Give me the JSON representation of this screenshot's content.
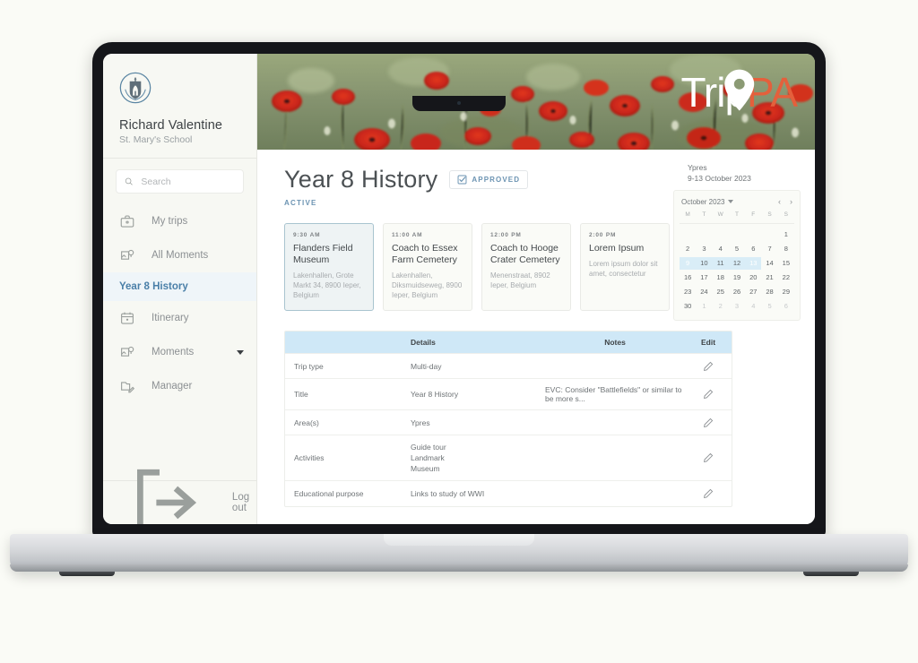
{
  "sidebar": {
    "user_name": "Richard Valentine",
    "user_org": "St. Mary's School",
    "logo_name": "school-crest-logo",
    "search_placeholder": "Search",
    "search_value": "",
    "items": [
      {
        "label": "My trips",
        "icon": "briefcase-icon"
      },
      {
        "label": "All Moments",
        "icon": "photo-pin-icon"
      }
    ],
    "section_label": "Year 8 History",
    "sub_items": [
      {
        "label": "Itinerary",
        "icon": "calendar-icon",
        "caret": false
      },
      {
        "label": "Moments",
        "icon": "photo-pin-icon",
        "caret": true
      },
      {
        "label": "Manager",
        "icon": "folder-edit-icon",
        "caret": false
      }
    ],
    "logout_label": "Log out",
    "logout_icon": "logout-icon"
  },
  "hero": {
    "image_alt": "poppy-field",
    "logo_part1": "Trip",
    "logo_part2": "PA",
    "logo_accent_color": "#e4603c",
    "pin_icon": "map-pin-icon"
  },
  "header": {
    "page_title": "Year 8 History",
    "badge_label": "APPROVED",
    "badge_icon": "check-square-icon",
    "status": "ACTIVE",
    "accent_color": "#6b93b2"
  },
  "itinerary_cards": [
    {
      "time": "9:30 AM",
      "title": "Flanders Field Museum",
      "address": "Lakenhallen, Grote Markt 34, 8900 Ieper, Belgium",
      "selected": true
    },
    {
      "time": "11:00 AM",
      "title": "Coach to Essex Farm Cemetery",
      "address": "Lakenhallen, Diksmuidseweg, 8900 Ieper, Belgium",
      "selected": false
    },
    {
      "time": "12:00 PM",
      "title": "Coach to Hooge Crater Cemetery",
      "address": "Menenstraat, 8902 Ieper, Belgium",
      "selected": false
    },
    {
      "time": "2:00 PM",
      "title": "Lorem Ipsum",
      "address": "Lorem ipsum dolor sit amet, consectetur",
      "selected": false
    }
  ],
  "table": {
    "headers": [
      "",
      "Details",
      "Notes",
      "Edit"
    ],
    "rows": [
      {
        "label": "Trip type",
        "details": "Multi-day",
        "notes": ""
      },
      {
        "label": "Title",
        "details": "Year 8 History",
        "notes": "EVC: Consider \"Battlefields\" or similar to be more s..."
      },
      {
        "label": "Area(s)",
        "details": "Ypres",
        "notes": ""
      },
      {
        "label": "Activities",
        "details": "Guide tour\nLandmark\nMuseum",
        "notes": ""
      },
      {
        "label": "Educational purpose",
        "details": "Links to study of WWI",
        "notes": ""
      }
    ],
    "edit_icon": "pencil-icon",
    "header_bg": "#cfe8f7"
  },
  "calendar": {
    "area": "Ypres",
    "date_range": "9-13 October 2023",
    "month_label": "October 2023",
    "prev_icon": "chevron-left-icon",
    "next_icon": "chevron-right-icon",
    "dow": [
      "M",
      "T",
      "W",
      "T",
      "F",
      "S",
      "S"
    ],
    "weeks": [
      [
        {
          "n": "",
          "t": "blank"
        },
        {
          "n": "",
          "t": "blank"
        },
        {
          "n": "",
          "t": "blank"
        },
        {
          "n": "",
          "t": "blank"
        },
        {
          "n": "",
          "t": "blank"
        },
        {
          "n": "",
          "t": "blank"
        },
        {
          "n": "1",
          "t": "day"
        }
      ],
      [
        {
          "n": "2",
          "t": "day"
        },
        {
          "n": "3",
          "t": "day"
        },
        {
          "n": "4",
          "t": "day"
        },
        {
          "n": "5",
          "t": "day"
        },
        {
          "n": "6",
          "t": "day"
        },
        {
          "n": "7",
          "t": "day"
        },
        {
          "n": "8",
          "t": "day"
        }
      ],
      [
        {
          "n": "9",
          "t": "sel-start"
        },
        {
          "n": "10",
          "t": "sel-outline"
        },
        {
          "n": "11",
          "t": "inrange"
        },
        {
          "n": "12",
          "t": "inrange"
        },
        {
          "n": "13",
          "t": "sel-end"
        },
        {
          "n": "14",
          "t": "day"
        },
        {
          "n": "15",
          "t": "day"
        }
      ],
      [
        {
          "n": "16",
          "t": "day"
        },
        {
          "n": "17",
          "t": "day"
        },
        {
          "n": "18",
          "t": "day"
        },
        {
          "n": "19",
          "t": "day"
        },
        {
          "n": "20",
          "t": "day"
        },
        {
          "n": "21",
          "t": "day"
        },
        {
          "n": "22",
          "t": "day"
        }
      ],
      [
        {
          "n": "23",
          "t": "day"
        },
        {
          "n": "24",
          "t": "day"
        },
        {
          "n": "25",
          "t": "day"
        },
        {
          "n": "26",
          "t": "day"
        },
        {
          "n": "27",
          "t": "day"
        },
        {
          "n": "28",
          "t": "day"
        },
        {
          "n": "29",
          "t": "day"
        }
      ],
      [
        {
          "n": "30",
          "t": "day"
        },
        {
          "n": "1",
          "t": "muted"
        },
        {
          "n": "2",
          "t": "muted"
        },
        {
          "n": "3",
          "t": "muted"
        },
        {
          "n": "4",
          "t": "muted"
        },
        {
          "n": "5",
          "t": "muted"
        },
        {
          "n": "6",
          "t": "muted"
        }
      ]
    ],
    "selected_color": "#3b87ab",
    "range_color": "#d9edf7"
  }
}
